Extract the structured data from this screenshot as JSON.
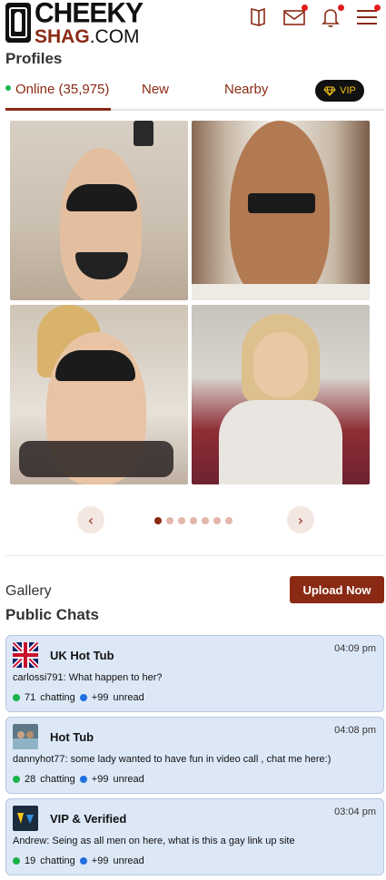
{
  "header": {
    "logo_line1": "CHEEKY",
    "logo_line2_a": "SHAG",
    "logo_line2_b": ".COM",
    "icons": [
      "book-icon",
      "mail-icon",
      "bell-icon",
      "menu-icon"
    ],
    "brand_color": "#8a2a14"
  },
  "profiles": {
    "title": "Profiles",
    "tabs": {
      "online": "Online (35,975)",
      "new": "New",
      "nearby": "Nearby",
      "vip": "VIP"
    },
    "carousel": {
      "total_dots": 7,
      "active_index": 0,
      "prev": "‹",
      "next": "›"
    }
  },
  "gallery": {
    "label": "Gallery",
    "upload_button": "Upload Now"
  },
  "public_chats": {
    "title": "Public Chats",
    "items": [
      {
        "name": "UK Hot Tub",
        "time": "04:09 pm",
        "message": "carlossi791:  What happen to her?",
        "chatting_count": "71",
        "chatting_label": "chatting",
        "unread_count": "+99",
        "unread_label": "unread",
        "avatar": "uk-flag-icon"
      },
      {
        "name": "Hot Tub",
        "time": "04:08 pm",
        "message": "dannyhot77:  some lady wanted to have fun in video call , chat me here:)",
        "chatting_count": "28",
        "chatting_label": "chatting",
        "unread_count": "+99",
        "unread_label": "unread",
        "avatar": "hot-tub-avatar"
      },
      {
        "name": "VIP & Verified",
        "time": "03:04 pm",
        "message": "Andrew:  Seing as all men on here, what is this a gay link up site",
        "chatting_count": "19",
        "chatting_label": "chatting",
        "unread_count": "+99",
        "unread_label": "unread",
        "avatar": "vip-verified-avatar"
      }
    ]
  }
}
